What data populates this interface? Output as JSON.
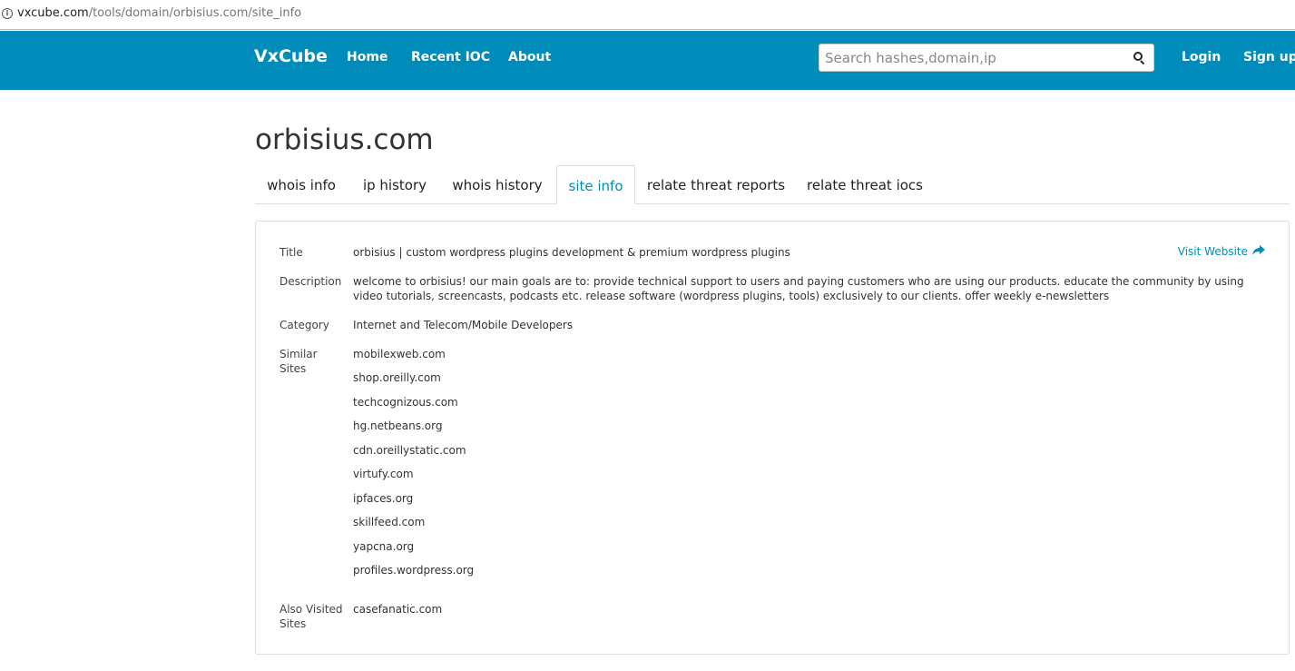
{
  "browser": {
    "url_host": "vxcube.com",
    "url_path": "/tools/domain/orbisius.com/site_info"
  },
  "nav": {
    "brand": "VxCube",
    "links": [
      "Home",
      "Recent IOC",
      "About"
    ],
    "search_placeholder": "Search hashes,domain,ip",
    "login": "Login",
    "signup": "Sign up"
  },
  "page": {
    "title": "orbisius.com",
    "tabs": [
      "whois info",
      "ip history",
      "whois history",
      "site info",
      "relate threat reports",
      "relate threat iocs"
    ],
    "active_tab": "site info"
  },
  "site_info": {
    "title_label": "Title",
    "title_value": "orbisius | custom wordpress plugins development & premium wordpress plugins",
    "visit_label": "Visit Website",
    "description_label": "Description",
    "description_value": "welcome to orbisius! our main goals are to: provide technical support to users and paying customers who are using our products. educate the community by using video tutorials, screencasts, podcasts etc. release software (wordpress plugins, tools) exclusively to our clients. offer weekly e-newsletters",
    "category_label": "Category",
    "category_value": "Internet and Telecom/Mobile Developers",
    "similar_label_1": "Similar",
    "similar_label_2": "Sites",
    "similar_sites": [
      "mobilexweb.com",
      "shop.oreilly.com",
      "techcognizous.com",
      "hg.netbeans.org",
      "cdn.oreillystatic.com",
      "virtufy.com",
      "ipfaces.org",
      "skillfeed.com",
      "yapcna.org",
      "profiles.wordpress.org"
    ],
    "also_label_1": "Also Visited",
    "also_label_2": "Sites",
    "also_visited": [
      "casefanatic.com"
    ]
  },
  "colors": {
    "navbar": "#008cba",
    "link": "#008cba"
  }
}
